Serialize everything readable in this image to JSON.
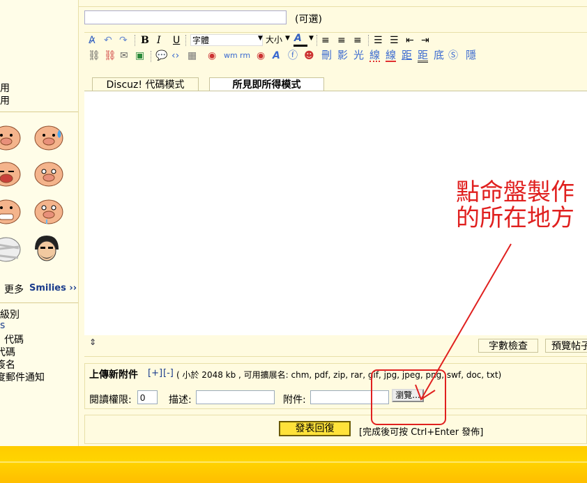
{
  "left": {
    "permission_label_1": "用",
    "permission_label_2": "用",
    "more_smilies_prefix": "更多",
    "more_smilies_link": "Smilies ››",
    "options": [
      "級別",
      "s",
      "! 代碼",
      "代碼",
      "簽名",
      "度郵件通知"
    ]
  },
  "subject": {
    "value": "",
    "optional_label": "(可選)"
  },
  "toolbar": {
    "bold": "B",
    "italic": "I",
    "underline": "U",
    "font_select": "字體",
    "size_select": "大小",
    "text_buttons": [
      "刪",
      "影",
      "光",
      "線",
      "線",
      "距",
      "距",
      "底",
      "隱"
    ]
  },
  "tabs": {
    "discuz_code": "Discuz! 代碼模式",
    "wysiwyg": "所見即所得模式"
  },
  "status": {
    "resize_glyph": "⇕",
    "word_count": "字數檢查",
    "preview": "預覽帖子"
  },
  "upload": {
    "title": "上傳新附件",
    "add": "[+]",
    "remove": "[-]",
    "limits": "( 小於 2048 kb , 可用擴展名: chm, pdf, zip, rar, gif, jpg, jpeg, png, swf, doc, txt)",
    "read_perm_label": "閱讀權限:",
    "read_perm_value": "0",
    "desc_label": "描述:",
    "desc_value": "",
    "attachment_label": "附件:",
    "attachment_value": "",
    "browse": "瀏覽..."
  },
  "submit": {
    "button": "發表回復",
    "hint": "[完成後可按 Ctrl+Enter 發佈]"
  },
  "annotation": {
    "line1": "點命盤製作",
    "line2": "的所在地方"
  },
  "colors": {
    "annotation": "#e0201f",
    "panel_bg": "#fffbe0",
    "footer": "#ffcc00",
    "submit_bg": "#ffe23a"
  }
}
